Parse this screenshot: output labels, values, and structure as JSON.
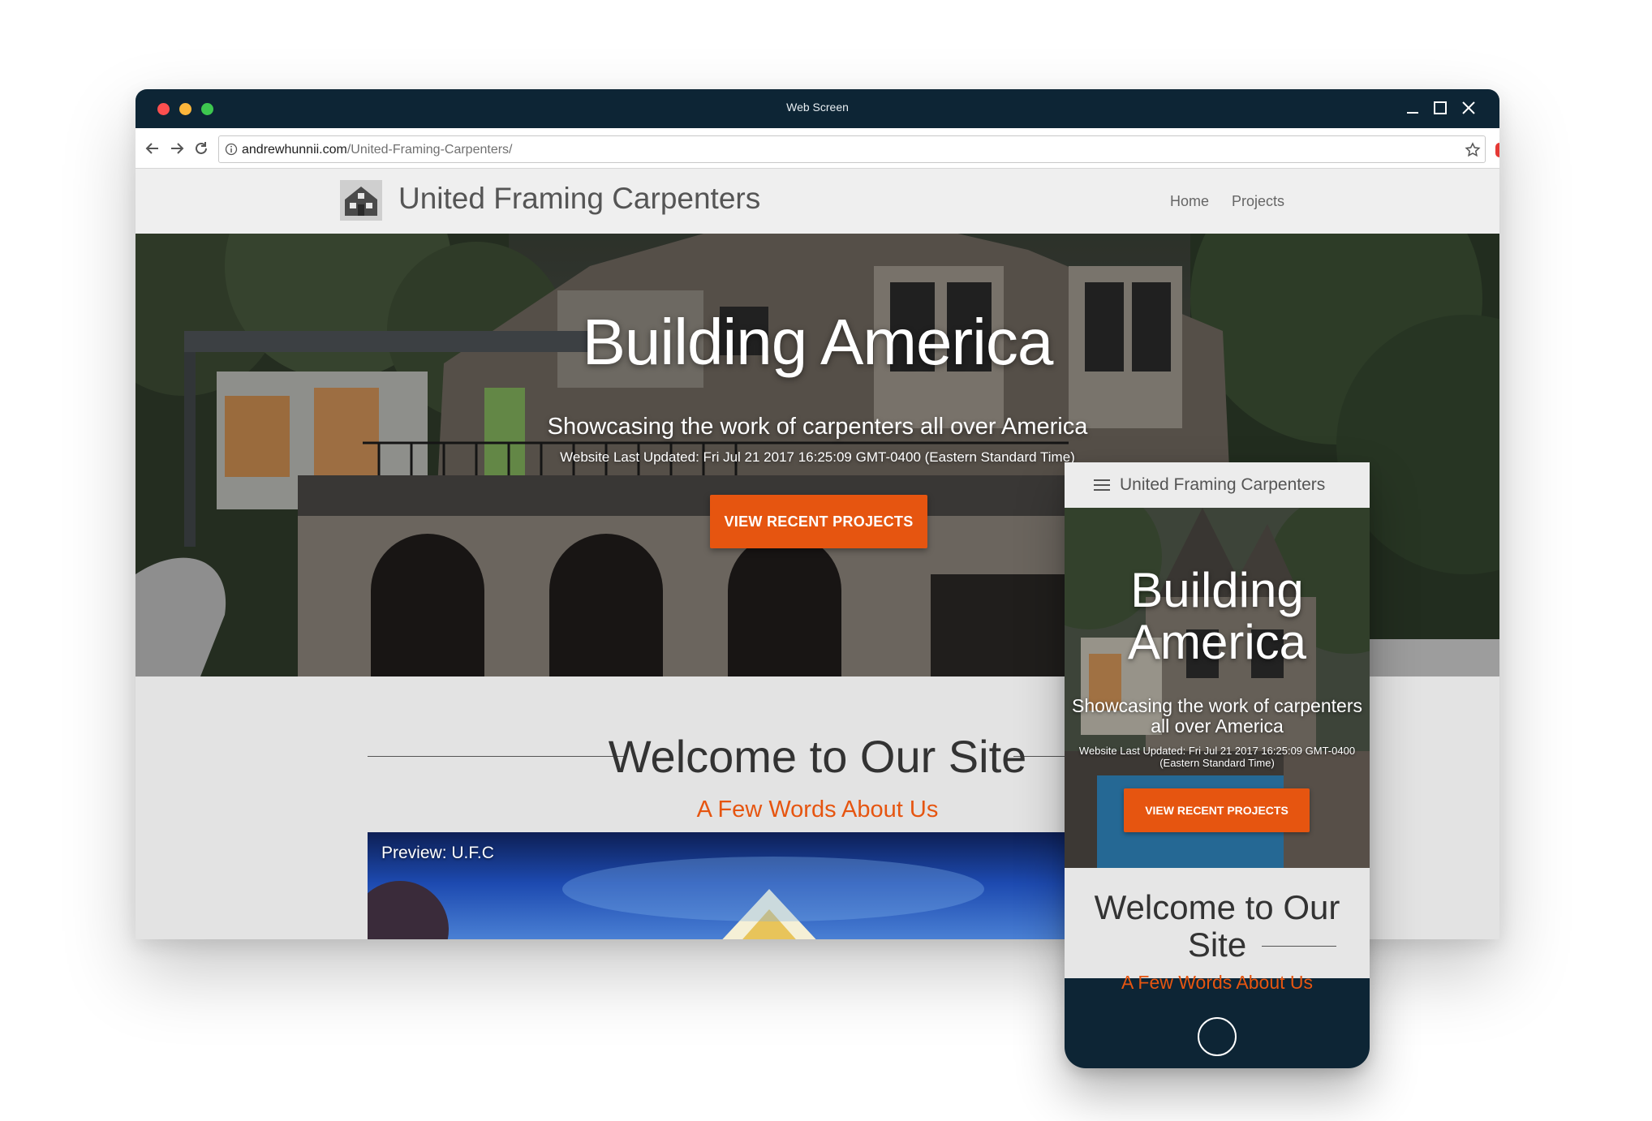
{
  "window": {
    "title": "Web Screen"
  },
  "browser": {
    "url_host": "andrewhunnii.com",
    "url_path": "/United-Framing-Carpenters/"
  },
  "site": {
    "brand": "United Framing Carpenters",
    "nav": [
      "Home",
      "Projects"
    ],
    "hero": {
      "title": "Building America",
      "subtitle": "Showcasing the work of carpenters all over America",
      "updated": "Website Last Updated: Fri Jul 21 2017 16:25:09 GMT-0400 (Eastern Standard Time)",
      "button": "VIEW RECENT PROJECTS"
    },
    "welcome": {
      "title": "Welcome to Our Site",
      "subtitle": "A Few Words About Us",
      "preview_label": "Preview: U.F.C"
    }
  },
  "phone": {
    "brand": "United Framing Carpenters",
    "hero": {
      "title": "Building America",
      "subtitle": "Showcasing the work of carpenters all over America",
      "updated": "Website Last Updated: Fri Jul 21 2017 16:25:09 GMT-0400 (Eastern Standard Time)",
      "button": "VIEW RECENT PROJECTS"
    },
    "welcome": {
      "title": "Welcome to Our Site",
      "subtitle": "A Few Words About Us"
    }
  },
  "colors": {
    "accent": "#e65510",
    "titlebar": "#0d2535",
    "header_bg": "#efefef"
  },
  "icons": [
    "back-arrow-icon",
    "forward-arrow-icon",
    "reload-icon",
    "info-icon",
    "star-icon",
    "minimize-icon",
    "maximize-icon",
    "close-icon",
    "house-logo-icon",
    "hamburger-menu-icon",
    "home-button-icon"
  ]
}
